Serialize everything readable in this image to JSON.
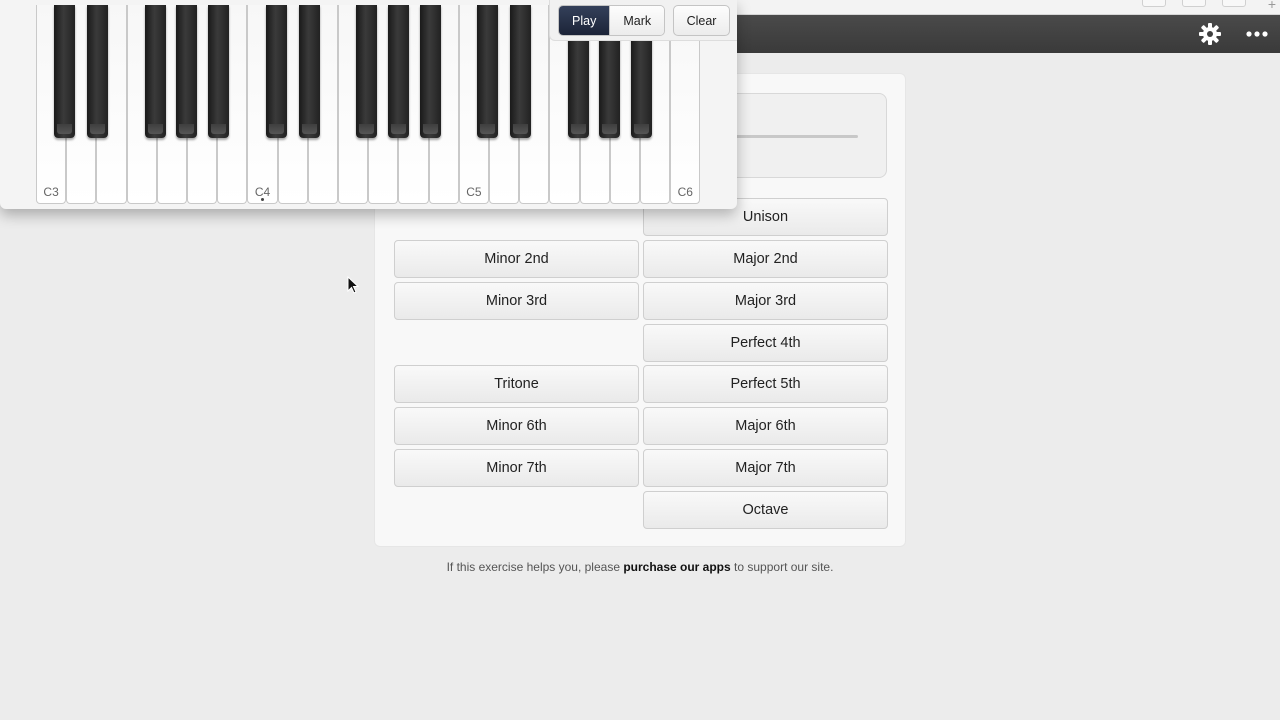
{
  "piano": {
    "toolbar": {
      "play_label": "Play",
      "mark_label": "Mark",
      "clear_label": "Clear"
    },
    "octave_labels": [
      "C3",
      "C4",
      "C5",
      "C6"
    ]
  },
  "answers": {
    "unison": "Unison",
    "minor_2nd": "Minor 2nd",
    "major_2nd": "Major 2nd",
    "minor_3rd": "Minor 3rd",
    "major_3rd": "Major 3rd",
    "perfect_4th": "Perfect 4th",
    "tritone": "Tritone",
    "perfect_5th": "Perfect 5th",
    "minor_6th": "Minor 6th",
    "major_6th": "Major 6th",
    "minor_7th": "Minor 7th",
    "major_7th": "Major 7th",
    "octave": "Octave"
  },
  "footer": {
    "text_before": "If this exercise helps you, please ",
    "link_text": "purchase our apps",
    "text_after": " to support our site."
  },
  "icons": {
    "settings": "gear-icon",
    "more": "more-icon"
  },
  "colors": {
    "header_bg": "#3f3f3f",
    "active_button": "#1f2a40",
    "page_bg": "#ececec"
  }
}
